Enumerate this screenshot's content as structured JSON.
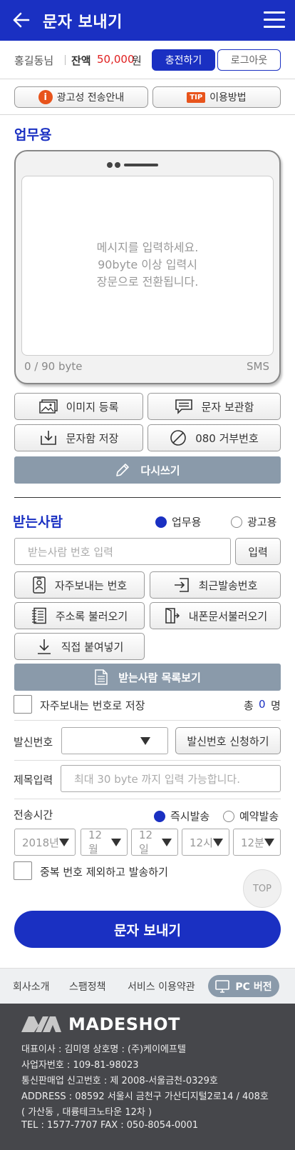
{
  "header": {
    "title": "문자 보내기"
  },
  "user": {
    "name": "홍길동님",
    "balance_label": "잔액",
    "balance": "50,000",
    "currency": "원",
    "charge": "충전하기",
    "logout": "로그아웃"
  },
  "tips": {
    "ad_guide": "광고성 전송안내",
    "tip_badge": "TIP",
    "usage": "이용방법"
  },
  "compose": {
    "section": "업무용",
    "placeholder_lines": [
      "메시지를 입력하세요.",
      "90byte 이상 입력시",
      "장문으로 전환됩니다."
    ],
    "byte_count": "0 / 90 byte",
    "type": "SMS",
    "buttons": {
      "image": "이미지 등록",
      "storage": "문자 보관함",
      "save": "문자함 저장",
      "reject": "080 거부번호",
      "rewrite": "다시쓰기"
    }
  },
  "recipients": {
    "section": "받는사람",
    "radio_business": "업무용",
    "radio_ad": "광고용",
    "input_placeholder": "받는사람 번호 입력",
    "input_btn": "입력",
    "buttons": {
      "frequent": "자주보내는 번호",
      "recent": "최근발송번호",
      "address": "주소록 불러오기",
      "import": "내폰문서불러오기",
      "paste": "직접 붙여넣기",
      "list": "받는사람 목록보기"
    },
    "save_frequent": "자주보내는 번호로 저장",
    "total_label": "총",
    "total": "0",
    "total_unit": "명"
  },
  "sender": {
    "label": "발신번호",
    "apply": "발신번호 신청하기"
  },
  "subject": {
    "label": "제목입력",
    "placeholder": "최대 30 byte 까지 입력 가능합니다."
  },
  "schedule": {
    "label": "전송시간",
    "now": "즉시발송",
    "reserve": "예약발송",
    "year": "2018년",
    "month": "12월",
    "day": "12일",
    "hour": "12시",
    "minute": "12분"
  },
  "dedupe": "중복 번호 제외하고 발송하기",
  "top": "TOP",
  "send": "문자 보내기",
  "footnav": {
    "about": "회사소개",
    "spam": "스팸정책",
    "terms": "서비스 이용약관",
    "pc": "PC 버전"
  },
  "footer": {
    "brand": "MADESHOT",
    "lines": [
      "대표이사 : 김미영      상호명 : (주)케이에프텔",
      "사업자번호 : 109-81-98023",
      "통신판매업 신고번호 : 제 2008-서울금천-0329호",
      "ADDRESS : 08592 서울시 금천구 가산디지털2로14 / 408호",
      "( 가산동 , 대륭테크노타운 12차 )",
      "TEL : 1577-7707      FAX : 050-8054-0001"
    ]
  }
}
